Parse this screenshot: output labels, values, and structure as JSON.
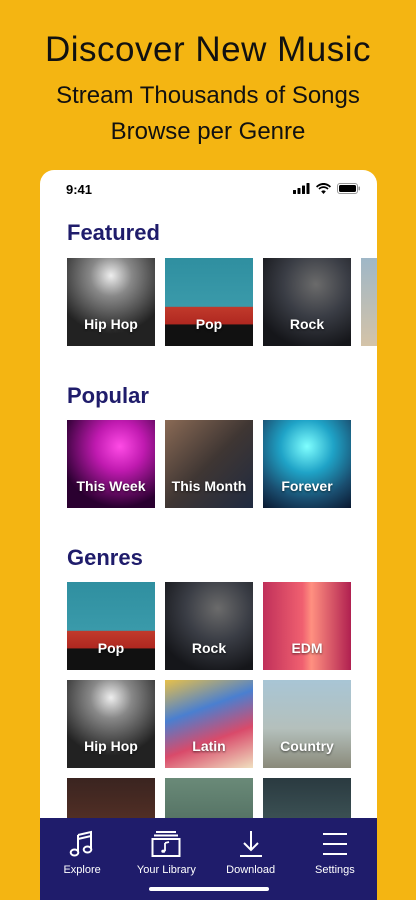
{
  "promo": {
    "title": "Discover New Music",
    "subtitle1": "Stream Thousands of Songs",
    "subtitle2": "Browse per Genre"
  },
  "status": {
    "time": "9:41"
  },
  "sections": {
    "featured": {
      "title": "Featured",
      "tiles": [
        {
          "label": "Hip Hop",
          "bg": "concert"
        },
        {
          "label": "Pop",
          "bg": "pop"
        },
        {
          "label": "Rock",
          "bg": "rock"
        }
      ]
    },
    "popular": {
      "title": "Popular",
      "tiles": [
        {
          "label": "This Week",
          "bg": "week"
        },
        {
          "label": "This Month",
          "bg": "month"
        },
        {
          "label": "Forever",
          "bg": "forever"
        }
      ]
    },
    "genres": {
      "title": "Genres",
      "row1": [
        {
          "label": "Pop",
          "bg": "pop"
        },
        {
          "label": "Rock",
          "bg": "rock"
        },
        {
          "label": "EDM",
          "bg": "edm"
        }
      ],
      "row2": [
        {
          "label": "Hip Hop",
          "bg": "concert"
        },
        {
          "label": "Latin",
          "bg": "latin"
        },
        {
          "label": "Country",
          "bg": "country"
        }
      ]
    }
  },
  "tabs": [
    {
      "label": "Explore",
      "icon": "music-note-icon"
    },
    {
      "label": "Your Library",
      "icon": "library-icon"
    },
    {
      "label": "Download",
      "icon": "download-icon"
    },
    {
      "label": "Settings",
      "icon": "menu-icon"
    }
  ],
  "colors": {
    "background": "#F4B512",
    "brand_navy": "#1F1C6B",
    "card": "#FFFFFF"
  }
}
